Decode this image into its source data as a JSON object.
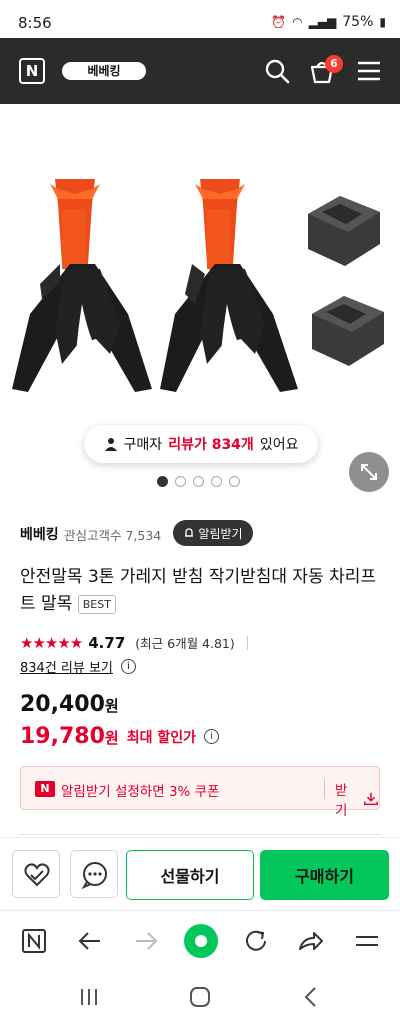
{
  "status_bar": {
    "time": "8:56",
    "battery": "75%"
  },
  "header": {
    "store_label": "베베킹",
    "cart_count": "6"
  },
  "gallery": {
    "review_pill": {
      "prefix": "구매자",
      "highlight": "리뷰가 834개",
      "suffix": "있어요"
    },
    "page_count": 5,
    "active_page": 1
  },
  "store": {
    "name": "베베킹",
    "interest": "관심고객수 7,534",
    "notify_label": "알림받기"
  },
  "product": {
    "title": "안전말목 3톤 가레지 받침 작기받침대 자동 차리프트 말목",
    "badge": "BEST",
    "rating": "4.77",
    "stars": "★★★★★",
    "recent_rating": "(최근 6개월 4.81)",
    "review_link": "834건 리뷰 보기",
    "info_icon": "i",
    "price": "20,400",
    "sale_price": "19,780",
    "won": "원",
    "max_discount_label": "최대 할인가"
  },
  "coupon": {
    "badge": "N",
    "text": "알림받기 설정하면 3% 쿠폰",
    "get_label": "받기"
  },
  "actions": {
    "gift_label": "선물하기",
    "buy_label": "구매하기"
  },
  "colors": {
    "brand_green": "#03c75a",
    "accent_red": "#e4002b",
    "header_bg": "#2b2b2b"
  }
}
